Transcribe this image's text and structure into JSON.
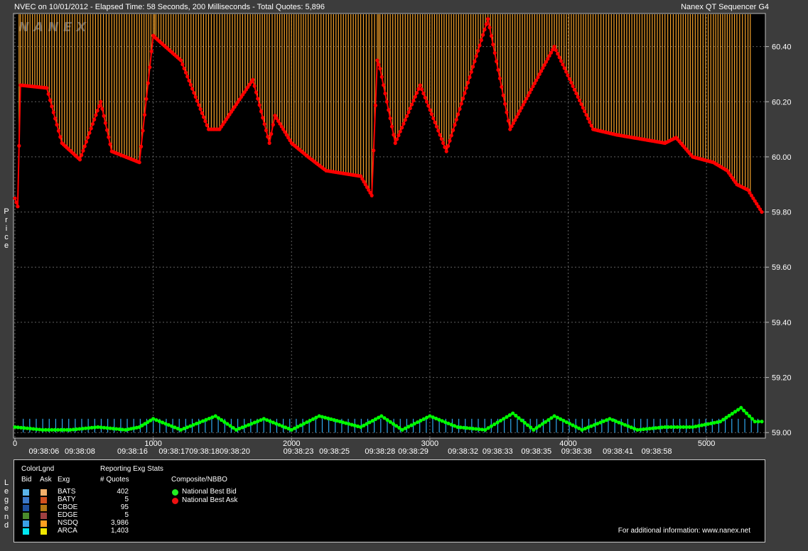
{
  "header": {
    "left": "NVEC on 10/01/2012  -  Elapsed Time: 58 Seconds, 200 Milliseconds  -  Total Quotes: 5,896",
    "right": "Nanex QT Sequencer G4",
    "watermark": "N A N E X"
  },
  "y_axis_title": "Price",
  "legend_side_title": "Legend",
  "chart_data": {
    "type": "line",
    "title": "NVEC on 10/01/2012  -  Elapsed Time: 58 Seconds, 200 Milliseconds  -  Total Quotes: 5,896",
    "ylabel": "Price",
    "xlabel": "",
    "ylim": [
      58.98,
      60.52
    ],
    "xlim": [
      0,
      5400
    ],
    "yticks": [
      "60.40",
      "60.20",
      "60.00",
      "59.80",
      "59.60",
      "59.40",
      "59.20",
      "59.00"
    ],
    "ytick_values": [
      60.4,
      60.2,
      60.0,
      59.8,
      59.6,
      59.4,
      59.2,
      59.0
    ],
    "xticks_seq": [
      "0",
      "1000",
      "2000",
      "3000",
      "4000",
      "5000"
    ],
    "xticks_seq_values": [
      0,
      1000,
      2000,
      3000,
      4000,
      5000
    ],
    "xticks_time": [
      "09:38:06",
      "09:38:08",
      "09:38:16",
      "09:38:17",
      "09:38:18",
      "09:38:20",
      "09:38:23",
      "09:38:25",
      "09:38:28",
      "09:38:29",
      "09:38:32",
      "09:38:33",
      "09:38:35",
      "09:38:38",
      "09:38:41",
      "09:38:58"
    ],
    "xticks_time_values": [
      210,
      470,
      850,
      1150,
      1370,
      1590,
      2050,
      2310,
      2640,
      2880,
      3240,
      3490,
      3770,
      4060,
      4360,
      4640
    ],
    "grid": true,
    "series": [
      {
        "name": "National Best Ask",
        "color": "#ff0000",
        "x": [
          0,
          20,
          40,
          230,
          340,
          470,
          620,
          700,
          900,
          1000,
          1020,
          1200,
          1400,
          1480,
          1720,
          1840,
          1880,
          2000,
          2120,
          2250,
          2500,
          2580,
          2620,
          2640,
          2750,
          2930,
          3120,
          3420,
          3580,
          3900,
          4180,
          4350,
          4700,
          4780,
          4900,
          5050,
          5150,
          5220,
          5300,
          5400
        ],
        "y": [
          59.85,
          59.82,
          60.26,
          60.25,
          60.05,
          59.99,
          60.2,
          60.02,
          59.98,
          60.44,
          60.43,
          60.35,
          60.1,
          60.1,
          60.28,
          60.05,
          60.15,
          60.05,
          60.0,
          59.95,
          59.93,
          59.86,
          60.35,
          60.32,
          60.05,
          60.26,
          60.02,
          60.5,
          60.1,
          60.4,
          60.1,
          60.08,
          60.05,
          60.07,
          60.0,
          59.98,
          59.95,
          59.9,
          59.88,
          59.8
        ]
      },
      {
        "name": "National Best Bid",
        "color": "#00ff00",
        "x": [
          0,
          200,
          400,
          600,
          800,
          900,
          1000,
          1200,
          1450,
          1600,
          1800,
          2000,
          2200,
          2500,
          2650,
          2800,
          3000,
          3200,
          3400,
          3600,
          3750,
          3900,
          4100,
          4300,
          4500,
          4700,
          4900,
          5100,
          5250,
          5350,
          5400
        ],
        "y": [
          59.02,
          59.01,
          59.01,
          59.02,
          59.01,
          59.02,
          59.05,
          59.01,
          59.06,
          59.01,
          59.05,
          59.01,
          59.06,
          59.02,
          59.06,
          59.01,
          59.06,
          59.02,
          59.01,
          59.07,
          59.01,
          59.06,
          59.01,
          59.05,
          59.01,
          59.02,
          59.02,
          59.04,
          59.09,
          59.04,
          59.04
        ]
      }
    ]
  },
  "legend": {
    "color_legend_title": "ColorLgnd",
    "col_bid": "Bid",
    "col_ask": "Ask",
    "col_exg": "Exg",
    "stats_title": "Reporting Exg Stats",
    "stats_col": "# Quotes",
    "composite_title": "Composite/NBBO",
    "exchanges": [
      {
        "name": "BATS",
        "quotes": "402",
        "bid_color": "#5ab4ea",
        "ask_color": "#f4b06a"
      },
      {
        "name": "BATY",
        "quotes": "5",
        "bid_color": "#3c78c8",
        "ask_color": "#d2501e"
      },
      {
        "name": "CBOE",
        "quotes": "95",
        "bid_color": "#1e50a0",
        "ask_color": "#b47814"
      },
      {
        "name": "EDGE",
        "quotes": "5",
        "bid_color": "#4a8a2c",
        "ask_color": "#a04040"
      },
      {
        "name": "NSDQ",
        "quotes": "3,986",
        "bid_color": "#3aa0e6",
        "ask_color": "#ffa020"
      },
      {
        "name": "ARCA",
        "quotes": "1,403",
        "bid_color": "#00e6f0",
        "ask_color": "#f0e600"
      }
    ],
    "nbbo": [
      {
        "name": "National Best Bid",
        "color": "#22ee22"
      },
      {
        "name": "National Best Ask",
        "color": "#ee1111"
      }
    ],
    "footer": "For additional information: www.nanex.net"
  }
}
